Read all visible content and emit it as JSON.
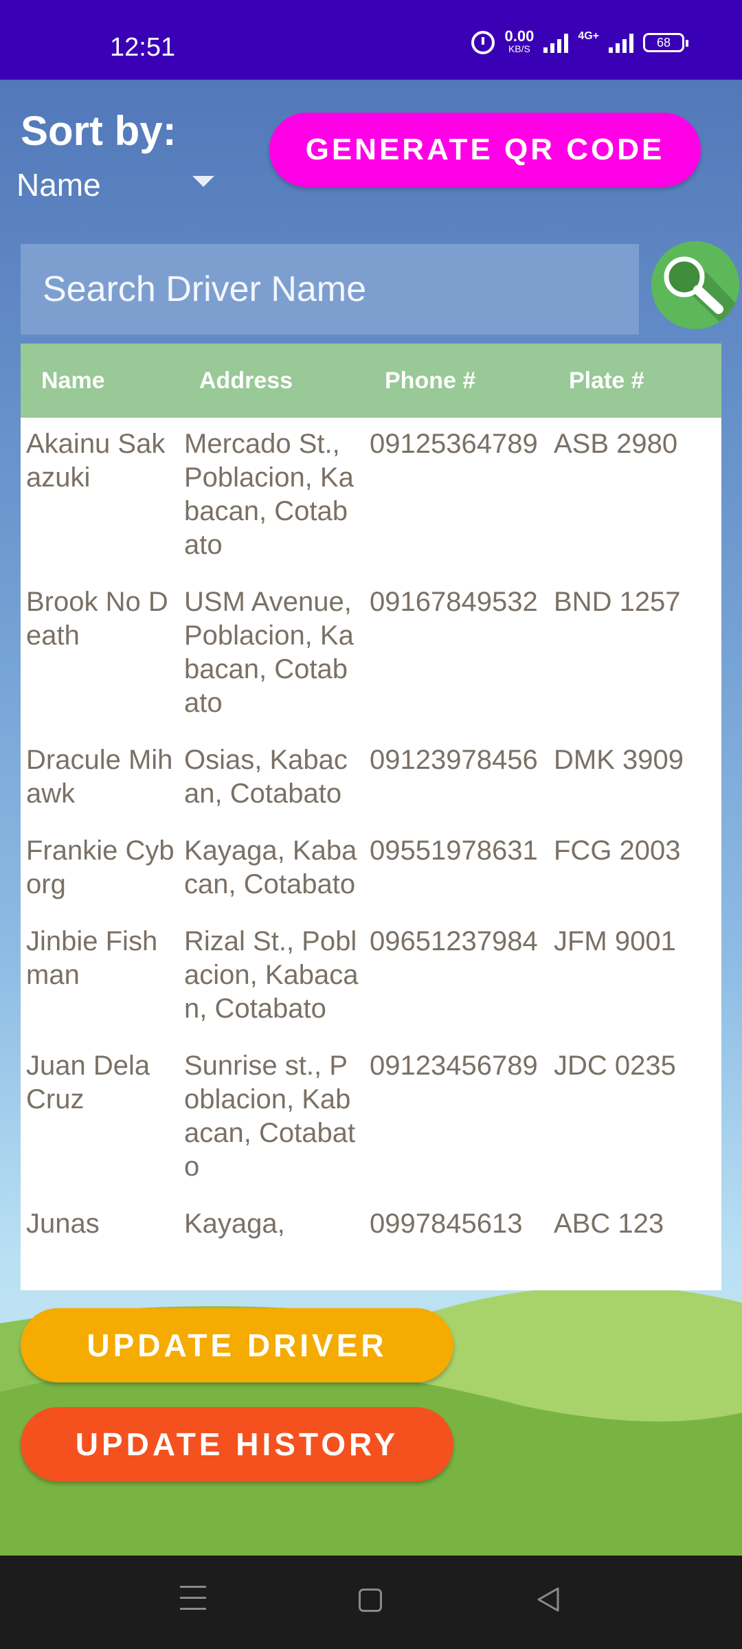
{
  "status_bar": {
    "time": "12:51",
    "net_speed": "0.00",
    "net_unit": "KB/S",
    "network": "4G+",
    "battery": "68"
  },
  "sort": {
    "label": "Sort by:",
    "selected": "Name"
  },
  "qr_button": {
    "label": "GENERATE QR CODE"
  },
  "search": {
    "placeholder": "Search Driver Name"
  },
  "table": {
    "headers": [
      "Name",
      "Address",
      "Phone #",
      "Plate #"
    ],
    "rows": [
      {
        "name": "Akainu Sakazuki",
        "address": "Mercado St., Poblacion, Kabacan, Cotabato",
        "phone": "09125364789",
        "plate": "ASB 2980"
      },
      {
        "name": "Brook No Death",
        "address": "USM Avenue, Poblacion, Kabacan, Cotabato",
        "phone": "09167849532",
        "plate": "BND 1257"
      },
      {
        "name": "Dracule Mihawk",
        "address": "Osias, Kabacan, Cotabato",
        "phone": "09123978456",
        "plate": "DMK 3909"
      },
      {
        "name": "Frankie Cyborg",
        "address": "Kayaga, Kabacan, Cotabato",
        "phone": "09551978631",
        "plate": "FCG 2003"
      },
      {
        "name": "Jinbie Fishman",
        "address": "Rizal St., Poblacion, Kabacan, Cotabato",
        "phone": "09651237984",
        "plate": "JFM 9001"
      },
      {
        "name": "Juan Dela Cruz",
        "address": "Sunrise st., Poblacion, Kabacan, Cotabato",
        "phone": "09123456789",
        "plate": "JDC 0235"
      },
      {
        "name": "Junas",
        "address": "Kayaga,",
        "phone": "0997845613",
        "plate": "ABC 123"
      }
    ]
  },
  "actions": {
    "update_driver": "UPDATE DRIVER",
    "update_history": "UPDATE HISTORY"
  },
  "colors": {
    "status_bar": "#3a00b5",
    "qr_button": "#ff00e6",
    "update_driver": "#f5ab00",
    "update_history": "#f4511e",
    "table_header": "#98c996",
    "search_button": "#5db85a"
  },
  "icons": {
    "search": "magnifier-icon",
    "alarm": "alarm-icon",
    "signal": "signal-icon",
    "battery": "battery-icon"
  }
}
